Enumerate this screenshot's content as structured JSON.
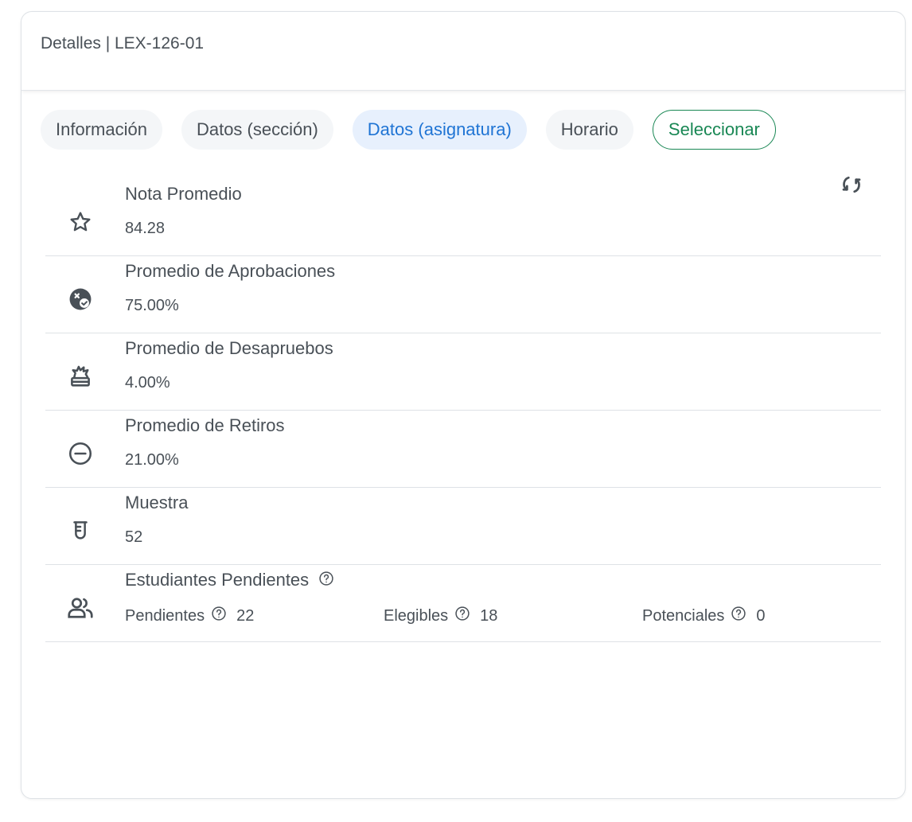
{
  "header": {
    "title": "Detalles | LEX-126-01"
  },
  "tabs": [
    {
      "label": "Información"
    },
    {
      "label": "Datos (sección)"
    },
    {
      "label": "Datos (asignatura)"
    },
    {
      "label": "Horario"
    },
    {
      "label": "Seleccionar"
    }
  ],
  "colors": {
    "active_tab_text": "#1f74d4",
    "active_tab_bg": "#e7f0fd",
    "select_accent": "#198754",
    "text": "#495057"
  },
  "stats": [
    {
      "label": "Nota Promedio",
      "value": "84.28",
      "icon": "star-icon"
    },
    {
      "label": "Promedio de Aprobaciones",
      "value": "75.00%",
      "icon": "approval-badge-icon"
    },
    {
      "label": "Promedio de Desapruebos",
      "value": "4.00%",
      "icon": "explosion-icon"
    },
    {
      "label": "Promedio de Retiros",
      "value": "21.00%",
      "icon": "minus-circle-icon"
    },
    {
      "label": "Muestra",
      "value": "52",
      "icon": "test-tube-icon"
    }
  ],
  "pending": {
    "label": "Estudiantes Pendientes",
    "icon": "users-icon",
    "items": [
      {
        "label": "Pendientes",
        "value": "22"
      },
      {
        "label": "Elegibles",
        "value": "18"
      },
      {
        "label": "Potenciales",
        "value": "0"
      }
    ]
  }
}
